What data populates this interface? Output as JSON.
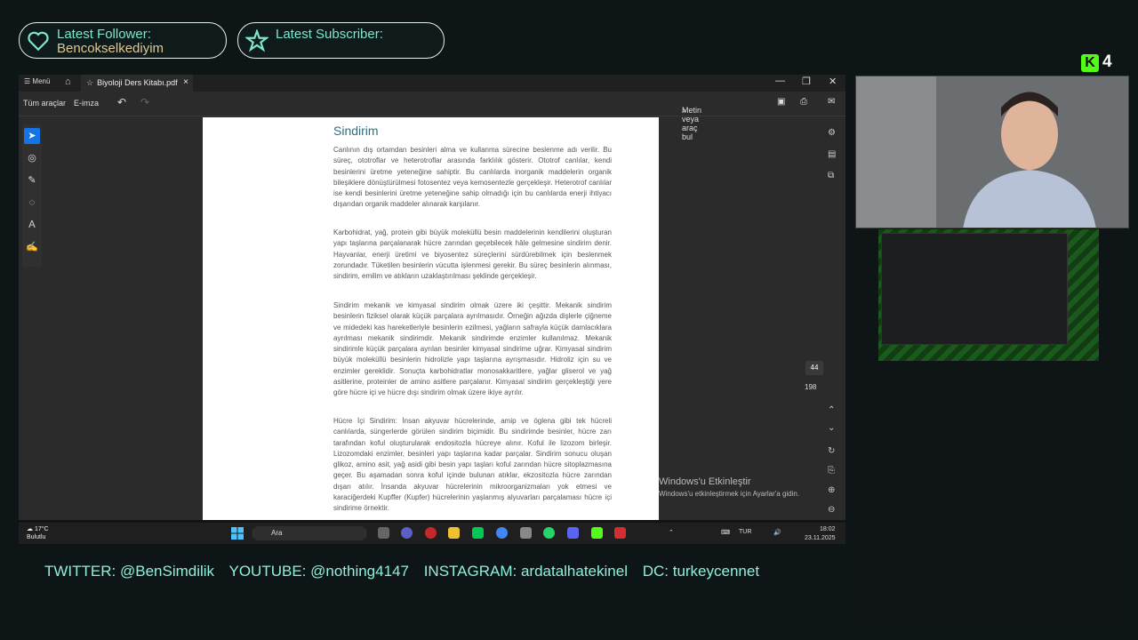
{
  "overlay": {
    "follower_title": "Latest Follower:",
    "follower_name": "Bencokselkediyim",
    "subscriber_title": "Latest Subscriber:",
    "subscriber_name": "",
    "kick_count": "4"
  },
  "window": {
    "menu_label": "Menü",
    "tab_title": "Biyoloji Ders Kitabı.pdf",
    "toolbar": {
      "all_tools": "Tüm araçlar",
      "esign": "E-imza",
      "search": "Metin veya araç bul"
    },
    "page_current": "44",
    "page_total": "198"
  },
  "document": {
    "heading": "Sindirim",
    "paragraphs": [
      "Canlının dış ortamdan besinleri alma ve kullanma sürecine beslenme adı verilir. Bu süreç, ototroflar ve heterotroflar arasında farklılık gösterir. Ototrof canlılar, kendi besinlerini üretme yeteneğine sahiptir. Bu canlılarda inorganik maddelerin organik bileşiklere dönüştürülmesi fotosentez veya kemosentezle gerçekleşir. Heterotrof canlılar ise kendi besinlerini üretme yeteneğine sahip olmadığı için bu canlılarda enerji ihtiyacı dışarıdan organik maddeler alınarak karşılanır.",
      "Karbohidrat, yağ, protein gibi büyük moleküllü besin maddelerinin kendilerini oluşturan yapı taşlarına parçalanarak hücre zarından geçebilecek hâle gelmesine sindirim denir. Hayvanlar, enerji üretimi ve biyosentez süreçlerini sürdürebilmek için beslenmek zorundadır. Tüketilen besinlerin vücutta işlenmesi gerekir. Bu süreç besinlerin alınması, sindirim, emilim ve atıkların uzaklaştırılması şeklinde gerçekleşir.",
      "Sindirim mekanik ve kimyasal sindirim olmak üzere iki çeşittir. Mekanik sindirim besinlerin fiziksel olarak küçük parçalara ayrılmasıdır. Örneğin ağızda dişlerle çiğneme ve midedeki kas hareketleriyle besinlerin ezilmesi, yağların safrayla küçük damlacıklara ayrılması mekanik sindirimdir. Mekanik sindirimde enzimler kullanılmaz. Mekanik sindirimle küçük parçalara ayrılan besinler kimyasal sindirime uğrar. Kimyasal sindirim büyük moleküllü besinlerin hidrolizle yapı taşlarına ayrışmasıdır. Hidroliz için su ve enzimler gereklidir. Sonuçta karbohidratlar monosakkaritlere, yağlar gliserol ve yağ asitlerine, proteinler de amino asitlere parçalanır. Kimyasal sindirim gerçekleştiği yere göre hücre içi ve hücre dışı sindirim olmak üzere ikiye ayrılır.",
      "Hücre İçi Sindirim: İnsan akyuvar hücrelerinde, amip ve öglena gibi tek hücreli canlılarda, süngerlerde görülen sindirim biçimidir. Bu sindirimde besinler, hücre zarı tarafından koful oluşturularak endositozla hücreye alınır. Koful ile lizozom birleşir. Lizozomdaki enzimler, besinleri yapı taşlarına kadar parçalar. Sindirim sonucu oluşan glikoz, amino asit, yağ asidi gibi besin yapı taşları koful zarından hücre sitoplazmasına geçer. Bu aşamadan sonra koful içinde bulunan atıklar, ekzositozla hücre zarından dışarı atılır. İnsanda akyuvar hücrelerinin mikroorganizmaları yok etmesi ve karaciğerdeki Kupffer (Kupfer) hücrelerinin yaşlanmış alyuvarları parçalaması hücre içi sindirime örnektir."
    ]
  },
  "activation": {
    "line1": "Windows'u Etkinleştir",
    "line2": "Windows'u etkinleştirmek için Ayarlar'a gidin."
  },
  "taskbar": {
    "temp": "17°C",
    "condition": "Bulutlu",
    "search_label": "Ara",
    "lang": "TUR",
    "time": "18:02",
    "date": "23.11.2025"
  },
  "socials": {
    "twitter": "TWITTER: @BenSimdilik",
    "youtube": "YOUTUBE: @nothing4147",
    "instagram": "INSTAGRAM: ardatalhatekinel",
    "discord": "DC: turkeycennet"
  },
  "colors": {
    "accent": "#7fe6d0",
    "name": "#e0c890",
    "kick": "#53fc18",
    "tool_active": "#1473e6"
  }
}
